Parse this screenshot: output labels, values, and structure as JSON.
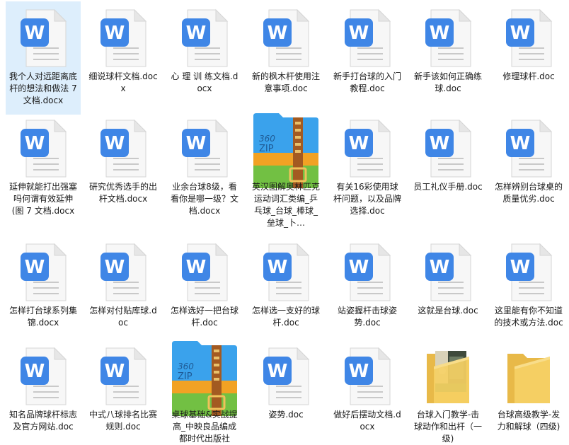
{
  "files": [
    {
      "name": "我个人对远距离底杆的想法和做法 7 文档.docx",
      "type": "docx",
      "icon": "word-doc-icon",
      "selected": true
    },
    {
      "name": "细说球杆文档.docx",
      "type": "docx",
      "icon": "word-doc-icon"
    },
    {
      "name": "心 理 训 练文档.docx",
      "type": "docx",
      "icon": "word-doc-icon"
    },
    {
      "name": "新的枫木杆使用注意事项.doc",
      "type": "doc",
      "icon": "word-doc-icon"
    },
    {
      "name": "新手打台球的入门教程.doc",
      "type": "doc",
      "icon": "word-doc-icon"
    },
    {
      "name": "新手该如何正确练球.doc",
      "type": "doc",
      "icon": "word-doc-icon"
    },
    {
      "name": "修理球杆.doc",
      "type": "doc",
      "icon": "word-doc-icon"
    },
    {
      "name": "延伸就能打出强塞吗何谓有效延伸(图 7 文档.docx",
      "type": "docx",
      "icon": "word-doc-icon"
    },
    {
      "name": "研究优秀选手的出杆文档.docx",
      "type": "docx",
      "icon": "word-doc-icon"
    },
    {
      "name": "业余台球8级，看看你是哪一级？文档.docx",
      "type": "docx",
      "icon": "word-doc-icon"
    },
    {
      "name": "英汉图解奥林匹克运动词汇类编_乒乓球_台球_棒球_垒球_卜…",
      "type": "zip",
      "icon": "zip-archive-icon"
    },
    {
      "name": "有关16彩使用球杆问题，以及品牌选择.doc",
      "type": "doc",
      "icon": "word-doc-icon"
    },
    {
      "name": "员工礼仪手册.doc",
      "type": "doc",
      "icon": "word-doc-icon"
    },
    {
      "name": "怎样辨别台球桌的质量优劣.doc",
      "type": "doc",
      "icon": "word-doc-icon"
    },
    {
      "name": "怎样打台球系列集锦.docx",
      "type": "docx",
      "icon": "word-doc-icon"
    },
    {
      "name": "怎样对付贴库球.doc",
      "type": "doc",
      "icon": "word-doc-icon"
    },
    {
      "name": "怎样选好一把台球杆.doc",
      "type": "doc",
      "icon": "word-doc-icon"
    },
    {
      "name": "怎样选一支好的球杆.doc",
      "type": "doc",
      "icon": "word-doc-icon"
    },
    {
      "name": "站姿握杆击球姿势.doc",
      "type": "doc",
      "icon": "word-doc-icon"
    },
    {
      "name": "这就是台球.doc",
      "type": "doc",
      "icon": "word-doc-icon"
    },
    {
      "name": "这里能有你不知道的技术或方法.doc",
      "type": "doc",
      "icon": "word-doc-icon"
    },
    {
      "name": "知名品牌球杆标志及官方网站.doc",
      "type": "doc",
      "icon": "word-doc-icon"
    },
    {
      "name": "中式八球排名比赛规则.doc",
      "type": "doc",
      "icon": "word-doc-icon"
    },
    {
      "name": "桌球基础&实战提高_中映良品编成都时代出版社",
      "type": "zip",
      "icon": "zip-archive-icon"
    },
    {
      "name": "姿势.doc",
      "type": "doc",
      "icon": "word-doc-icon"
    },
    {
      "name": "做好后摆动文档.docx",
      "type": "docx",
      "icon": "word-doc-icon"
    },
    {
      "name": "台球入门教学-击球动作和出杆（一级)",
      "type": "folder-photo",
      "icon": "folder-with-photo-icon"
    },
    {
      "name": "台球高级教学-发力和解球（四级)",
      "type": "folder",
      "icon": "folder-icon"
    }
  ],
  "colors": {
    "word_blue": "#3f86e6",
    "doc_page": "#f7f7f7",
    "doc_line": "#c9c9c9",
    "zip_blue": "#3aa2ec",
    "zip_orange": "#f2a224",
    "zip_green": "#72c043",
    "zip_zipper": "#a35a21",
    "folder": "#f5cf63",
    "selection": "#ddeefc"
  },
  "zip_text": {
    "line1": "360",
    "line2": "ZIP"
  },
  "word_glyph": "W"
}
